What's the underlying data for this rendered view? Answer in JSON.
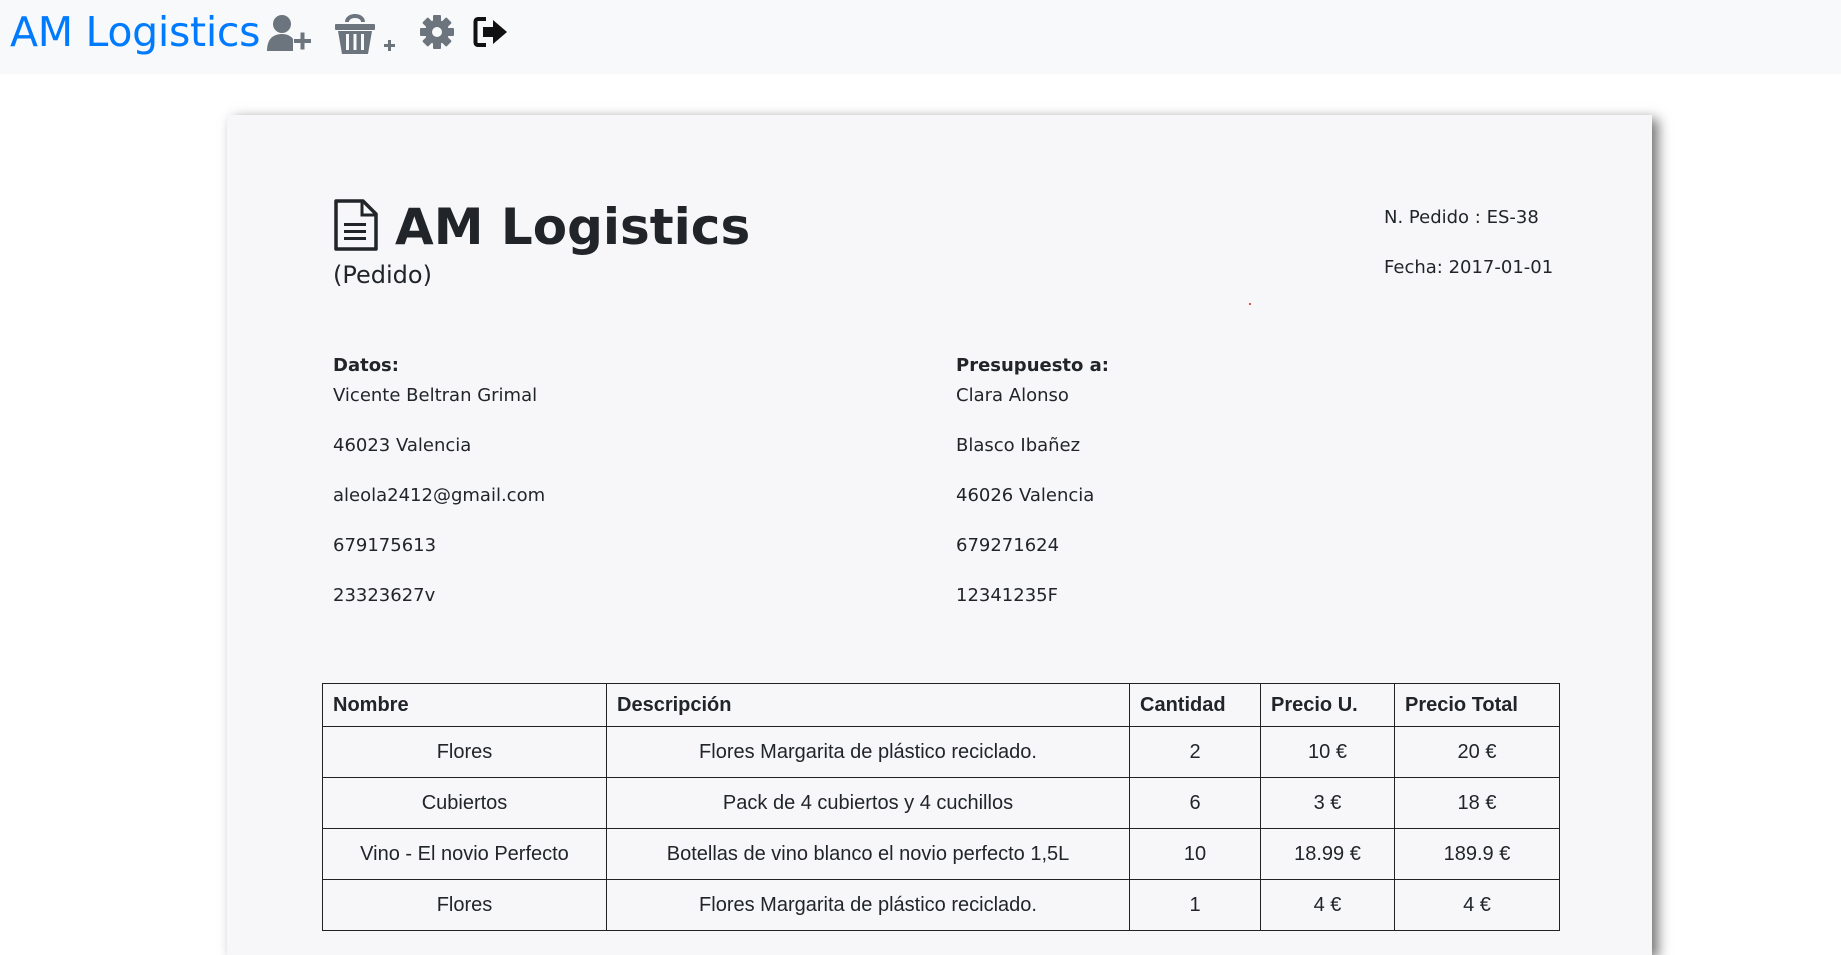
{
  "navbar": {
    "brand": "AM Logistics",
    "icons": [
      "add-user-icon",
      "add-basket-icon",
      "gear-icon",
      "logout-icon"
    ]
  },
  "document": {
    "title": "AM Logistics",
    "subtitle": "(Pedido)",
    "order_number": "N. Pedido : ES-38",
    "date": "Fecha: 2017-01-01",
    "from": {
      "heading": "Datos:",
      "lines": [
        "Vicente Beltran Grimal",
        "46023 Valencia",
        "aleola2412@gmail.com",
        "679175613",
        "23323627v"
      ]
    },
    "to": {
      "heading": "Presupuesto a:",
      "lines": [
        "Clara Alonso",
        "Blasco Ibañez",
        "46026 Valencia",
        "679271624",
        "12341235F"
      ]
    }
  },
  "table": {
    "headers": [
      "Nombre",
      "Descripción",
      "Cantidad",
      "Precio U.",
      "Precio Total"
    ],
    "rows": [
      [
        "Flores",
        "Flores Margarita de plástico reciclado.",
        "2",
        "10 €",
        "20 €"
      ],
      [
        "Cubiertos",
        "Pack de 4 cubiertos y 4 cuchillos",
        "6",
        "3 €",
        "18 €"
      ],
      [
        "Vino - El novio Perfecto",
        "Botellas de vino blanco el novio perfecto 1,5L",
        "10",
        "18.99 €",
        "189.9 €"
      ],
      [
        "Flores",
        "Flores Margarita de plástico reciclado.",
        "1",
        "4 €",
        "4 €"
      ]
    ]
  },
  "colors": {
    "brand": "#007bff",
    "navbar_bg": "#f8f9fa",
    "icon_gray": "#6c757d",
    "paper_bg": "#f7f7f9"
  }
}
